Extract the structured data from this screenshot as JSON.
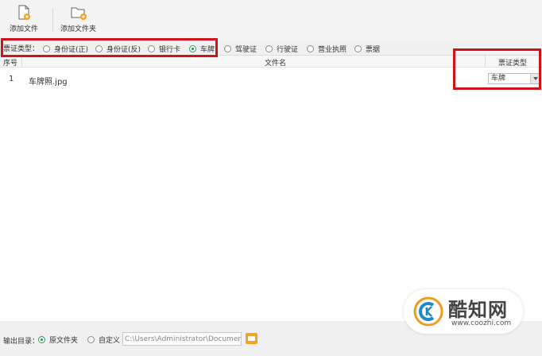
{
  "toolbar": {
    "add_file": "添加文件",
    "add_folder": "添加文件夹"
  },
  "ticket_type": {
    "label": "票证类型：",
    "options": [
      {
        "label": "身份证(正)",
        "selected": false
      },
      {
        "label": "身份证(反)",
        "selected": false
      },
      {
        "label": "银行卡",
        "selected": false
      },
      {
        "label": "车牌",
        "selected": true
      },
      {
        "label": "驾驶证",
        "selected": false
      },
      {
        "label": "行驶证",
        "selected": false
      },
      {
        "label": "营业执照",
        "selected": false
      },
      {
        "label": "票据",
        "selected": false
      }
    ]
  },
  "table": {
    "columns": [
      "序号",
      "文件名",
      "票证类型"
    ],
    "rows": [
      {
        "index": "1",
        "filename": "车牌照.jpg",
        "type": "车牌"
      }
    ]
  },
  "output": {
    "label": "输出目录：",
    "options": [
      {
        "label": "原文件夹",
        "selected": true
      },
      {
        "label": "自定义",
        "selected": false
      }
    ],
    "path": "C:\\Users\\Administrator\\Documents"
  },
  "watermark": {
    "title": "酷知网",
    "url": "www.coozhi.com"
  },
  "colors": {
    "annotation": "#d0121b",
    "radio_selected": "#1f8f4a",
    "folder_button": "#f6a21a"
  }
}
